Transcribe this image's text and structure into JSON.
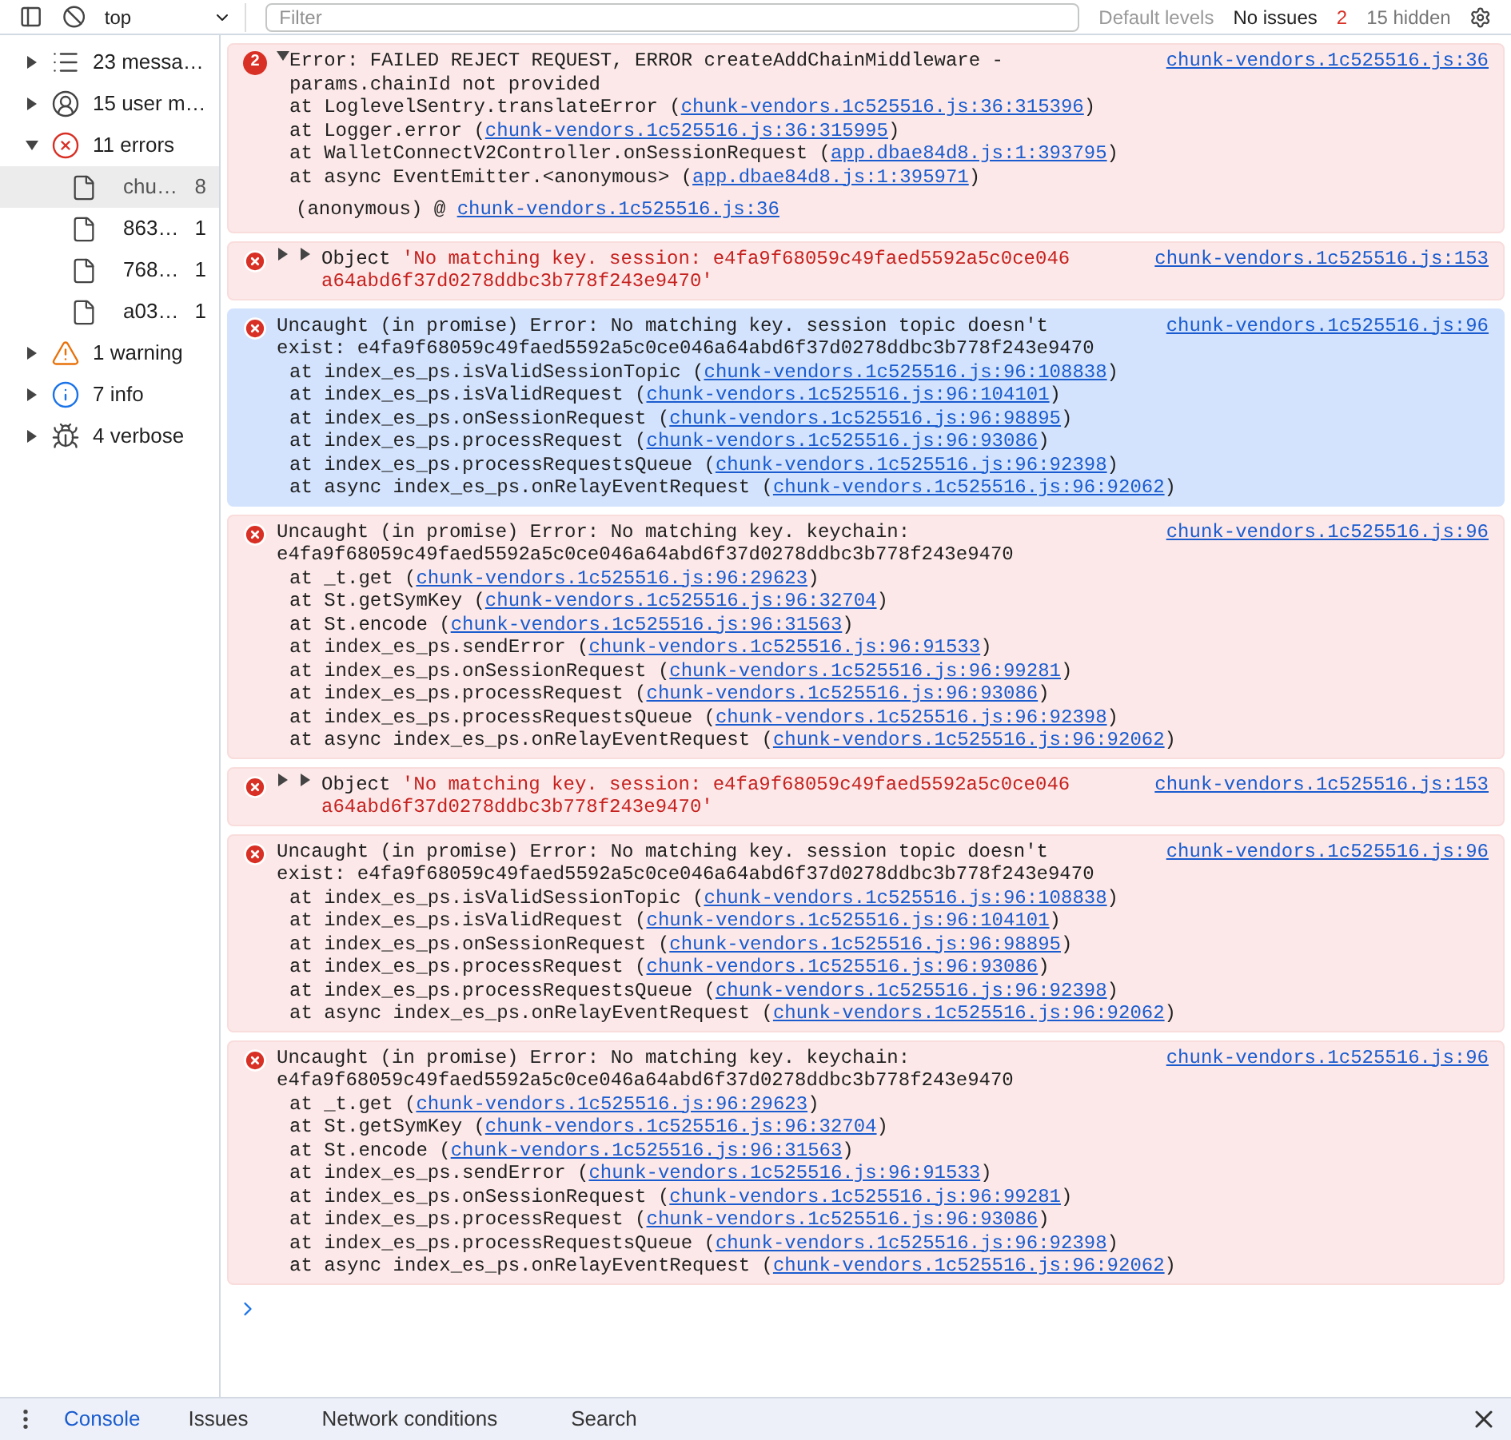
{
  "toolbar": {
    "context": "top",
    "filter": {
      "placeholder": "Filter"
    },
    "levels": "Default levels",
    "issues": "No issues",
    "issue_count": "2",
    "hidden": "15 hidden"
  },
  "sidebar": {
    "items": [
      {
        "kind": "messages",
        "label": "23 messa…",
        "expanded": false
      },
      {
        "kind": "user",
        "label": "15 user m…",
        "expanded": false
      },
      {
        "kind": "errors",
        "label": "11 errors",
        "expanded": true,
        "children": [
          {
            "label": "chu…",
            "count": "8",
            "selected": true
          },
          {
            "label": "863…",
            "count": "1",
            "selected": false
          },
          {
            "label": "768…",
            "count": "1",
            "selected": false
          },
          {
            "label": "a03…",
            "count": "1",
            "selected": false
          }
        ]
      },
      {
        "kind": "warning",
        "label": "1 warning",
        "expanded": false
      },
      {
        "kind": "info",
        "label": "7 info",
        "expanded": false
      },
      {
        "kind": "verbose",
        "label": "4 verbose",
        "expanded": false
      }
    ]
  },
  "messages": [
    {
      "kind": "error",
      "count": "2",
      "expanded": true,
      "selected": false,
      "text": "Error: FAILED REJECT REQUEST, ERROR createAddChainMiddleware - params.chainId not provided",
      "source": "chunk-vendors.1c525516.js:36",
      "frames": [
        {
          "before": "at LoglevelSentry.translateError (",
          "link": "chunk-vendors.1c525516.js:36:315396",
          "after": ")"
        },
        {
          "before": "at Logger.error (",
          "link": "chunk-vendors.1c525516.js:36:315995",
          "after": ")"
        },
        {
          "before": "at WalletConnectV2Controller.onSessionRequest (",
          "link": "app.dbae84d8.js:1:393795",
          "after": ")"
        },
        {
          "before": "at async EventEmitter.<anonymous> (",
          "link": "app.dbae84d8.js:1:395971",
          "after": ")"
        }
      ],
      "origin": {
        "before": "(anonymous) @",
        "link": "chunk-vendors.1c525516.js:36"
      }
    },
    {
      "kind": "object",
      "selected": false,
      "text": "Object",
      "value": "'No matching key. session: e4fa9f68059c49faed5592a5c0ce046a64abd6f37d0278ddbc3b778f243e9470'",
      "source": "chunk-vendors.1c525516.js:153"
    },
    {
      "kind": "uncaught",
      "selected": true,
      "text": "Uncaught (in promise) Error: No matching key. session topic doesn't exist: e4fa9f68059c49faed5592a5c0ce046a64abd6f37d0278ddbc3b778f243e9470",
      "source": "chunk-vendors.1c525516.js:96",
      "frames": [
        {
          "before": "at index_es_ps.isValidSessionTopic (",
          "link": "chunk-vendors.1c525516.js:96:108838",
          "after": ")"
        },
        {
          "before": "at index_es_ps.isValidRequest (",
          "link": "chunk-vendors.1c525516.js:96:104101",
          "after": ")"
        },
        {
          "before": "at index_es_ps.onSessionRequest (",
          "link": "chunk-vendors.1c525516.js:96:98895",
          "after": ")"
        },
        {
          "before": "at index_es_ps.processRequest (",
          "link": "chunk-vendors.1c525516.js:96:93086",
          "after": ")"
        },
        {
          "before": "at index_es_ps.processRequestsQueue (",
          "link": "chunk-vendors.1c525516.js:96:92398",
          "after": ")"
        },
        {
          "before": "at async index_es_ps.onRelayEventRequest (",
          "link": "chunk-vendors.1c525516.js:96:92062",
          "after": ")"
        }
      ]
    },
    {
      "kind": "uncaught",
      "selected": false,
      "text": "Uncaught (in promise) Error: No matching key. keychain: e4fa9f68059c49faed5592a5c0ce046a64abd6f37d0278ddbc3b778f243e9470",
      "source": "chunk-vendors.1c525516.js:96",
      "frames": [
        {
          "before": "at _t.get (",
          "link": "chunk-vendors.1c525516.js:96:29623",
          "after": ")"
        },
        {
          "before": "at St.getSymKey (",
          "link": "chunk-vendors.1c525516.js:96:32704",
          "after": ")"
        },
        {
          "before": "at St.encode (",
          "link": "chunk-vendors.1c525516.js:96:31563",
          "after": ")"
        },
        {
          "before": "at index_es_ps.sendError (",
          "link": "chunk-vendors.1c525516.js:96:91533",
          "after": ")"
        },
        {
          "before": "at index_es_ps.onSessionRequest (",
          "link": "chunk-vendors.1c525516.js:96:99281",
          "after": ")"
        },
        {
          "before": "at index_es_ps.processRequest (",
          "link": "chunk-vendors.1c525516.js:96:93086",
          "after": ")"
        },
        {
          "before": "at index_es_ps.processRequestsQueue (",
          "link": "chunk-vendors.1c525516.js:96:92398",
          "after": ")"
        },
        {
          "before": "at async index_es_ps.onRelayEventRequest (",
          "link": "chunk-vendors.1c525516.js:96:92062",
          "after": ")"
        }
      ]
    },
    {
      "kind": "object",
      "selected": false,
      "text": "Object",
      "value": "'No matching key. session: e4fa9f68059c49faed5592a5c0ce046a64abd6f37d0278ddbc3b778f243e9470'",
      "source": "chunk-vendors.1c525516.js:153"
    },
    {
      "kind": "uncaught",
      "selected": false,
      "text": "Uncaught (in promise) Error: No matching key. session topic doesn't exist: e4fa9f68059c49faed5592a5c0ce046a64abd6f37d0278ddbc3b778f243e9470",
      "source": "chunk-vendors.1c525516.js:96",
      "frames": [
        {
          "before": "at index_es_ps.isValidSessionTopic (",
          "link": "chunk-vendors.1c525516.js:96:108838",
          "after": ")"
        },
        {
          "before": "at index_es_ps.isValidRequest (",
          "link": "chunk-vendors.1c525516.js:96:104101",
          "after": ")"
        },
        {
          "before": "at index_es_ps.onSessionRequest (",
          "link": "chunk-vendors.1c525516.js:96:98895",
          "after": ")"
        },
        {
          "before": "at index_es_ps.processRequest (",
          "link": "chunk-vendors.1c525516.js:96:93086",
          "after": ")"
        },
        {
          "before": "at index_es_ps.processRequestsQueue (",
          "link": "chunk-vendors.1c525516.js:96:92398",
          "after": ")"
        },
        {
          "before": "at async index_es_ps.onRelayEventRequest (",
          "link": "chunk-vendors.1c525516.js:96:92062",
          "after": ")"
        }
      ]
    },
    {
      "kind": "uncaught",
      "selected": false,
      "text": "Uncaught (in promise) Error: No matching key. keychain: e4fa9f68059c49faed5592a5c0ce046a64abd6f37d0278ddbc3b778f243e9470",
      "source": "chunk-vendors.1c525516.js:96",
      "frames": [
        {
          "before": "at _t.get (",
          "link": "chunk-vendors.1c525516.js:96:29623",
          "after": ")"
        },
        {
          "before": "at St.getSymKey (",
          "link": "chunk-vendors.1c525516.js:96:32704",
          "after": ")"
        },
        {
          "before": "at St.encode (",
          "link": "chunk-vendors.1c525516.js:96:31563",
          "after": ")"
        },
        {
          "before": "at index_es_ps.sendError (",
          "link": "chunk-vendors.1c525516.js:96:91533",
          "after": ")"
        },
        {
          "before": "at index_es_ps.onSessionRequest (",
          "link": "chunk-vendors.1c525516.js:96:99281",
          "after": ")"
        },
        {
          "before": "at index_es_ps.processRequest (",
          "link": "chunk-vendors.1c525516.js:96:93086",
          "after": ")"
        },
        {
          "before": "at index_es_ps.processRequestsQueue (",
          "link": "chunk-vendors.1c525516.js:96:92398",
          "after": ")"
        },
        {
          "before": "at async index_es_ps.onRelayEventRequest (",
          "link": "chunk-vendors.1c525516.js:96:92062",
          "after": ")"
        }
      ]
    }
  ],
  "drawer_tabs": [
    {
      "label": "Console",
      "selected": true
    },
    {
      "label": "Issues",
      "selected": false
    },
    {
      "label": "Network conditions",
      "selected": false
    },
    {
      "label": "Search",
      "selected": false
    }
  ]
}
